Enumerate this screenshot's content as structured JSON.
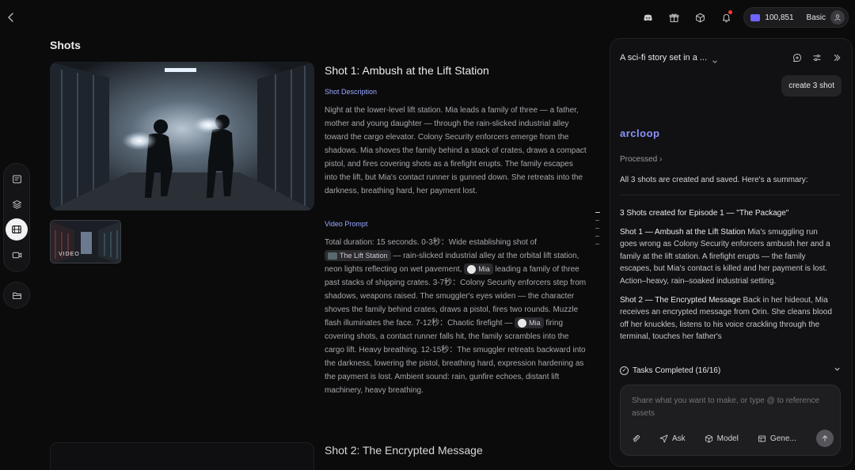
{
  "topbar": {
    "credits_value": "100,851",
    "plan": "Basic"
  },
  "main": {
    "page_title": "Shots",
    "thumb_label": "VIDEO",
    "shot1": {
      "title": "Shot 1: Ambush at the Lift Station",
      "description_label": "Shot Description",
      "description": "Night at the lower-level lift station. Mia leads a family of three — a father, mother and young daughter — through the rain-slicked industrial alley toward the cargo elevator. Colony Security enforcers emerge from the shadows. Mia shoves the family behind a stack of crates, draws a compact pistol, and fires covering shots as a firefight erupts. The family escapes into the lift, but Mia's contact runner is gunned down. She retreats into the darkness, breathing hard, her payment lost.",
      "prompt_label": "Video Prompt",
      "prompt": {
        "p1": "Total duration: 15 seconds. 0-3秒：Wide establishing shot of",
        "chip1": "The Lift Station",
        "p2": "— rain-slicked industrial alley at the orbital lift station, neon lights reflecting on wet pavement,",
        "chip2": "Mia",
        "p3": "leading a family of three past stacks of shipping crates. 3-7秒：Colony Security enforcers step from shadows, weapons raised. The smuggler's eyes widen — the character shoves the family behind crates, draws a pistol, fires two rounds. Muzzle flash illuminates the face. 7-12秒：Chaotic firefight —",
        "chip3": "Mia",
        "p4": "firing covering shots, a contact runner falls hit, the family scrambles into the cargo lift. Heavy breathing. 12-15秒：The smuggler retreats backward into the darkness, lowering the pistol, breathing hard, expression hardening as the payment is lost. Ambient sound: rain, gunfire echoes, distant lift machinery, heavy breathing."
      }
    },
    "shot2": {
      "title": "Shot 2: The Encrypted Message"
    }
  },
  "panel": {
    "conversation_title": "A sci-fi story set in a ...",
    "user_message": "create 3 shot",
    "brand": "arcloop",
    "processed": "Processed",
    "summary_intro": "All 3 shots are created and saved. Here's a summary:",
    "heading": "3 Shots created for Episode 1 — \"The Package\"",
    "item1_title": "Shot 1 — Ambush at the Lift Station",
    "item1_text": "Mia's smuggling run goes wrong as Colony Security enforcers ambush her and a family at the lift station. A firefight erupts — the family escapes, but Mia's contact is killed and her payment is lost. Action–heavy, rain–soaked industrial setting.",
    "item2_title": "Shot 2 — The Encrypted Message",
    "item2_text": "Back in her hideout, Mia receives an encrypted message from Orin. She cleans blood off her knuckles, listens to his voice crackling through the terminal, touches her father's",
    "tasks_label": "Tasks Completed (16/16)",
    "composer_placeholder": "Share what you want to make, or type @ to reference assets",
    "tools": {
      "ask": "Ask",
      "model": "Model",
      "generate": "Gene..."
    }
  }
}
